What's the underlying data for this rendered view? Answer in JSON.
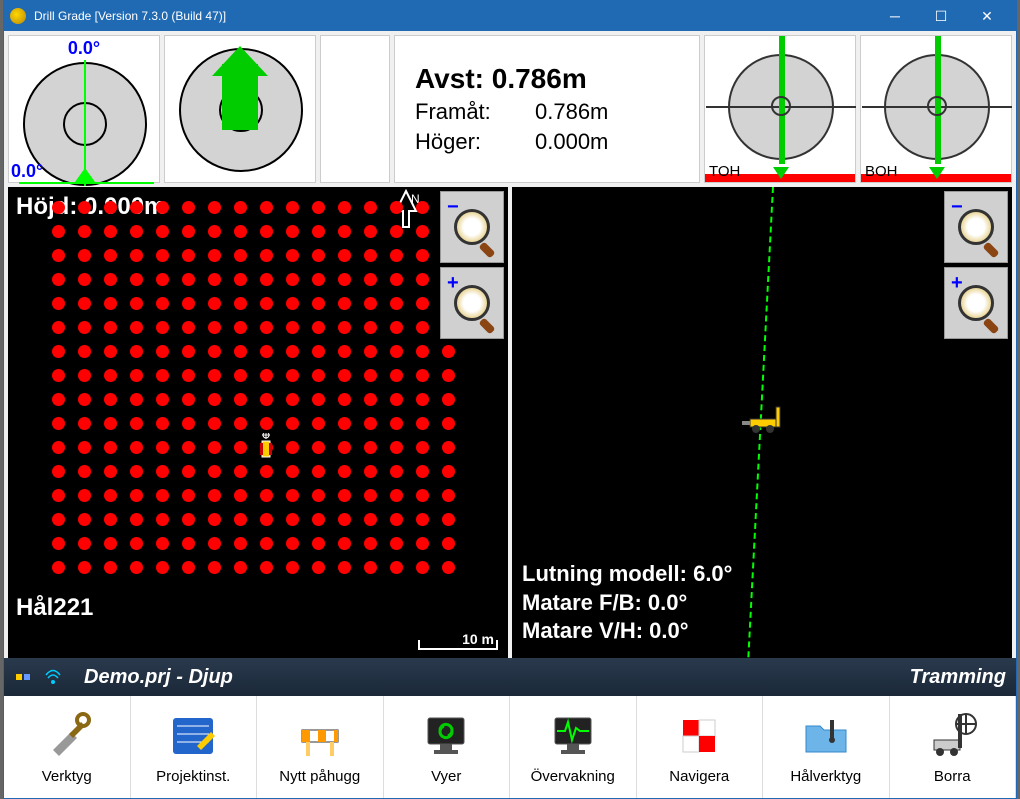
{
  "window": {
    "title": "Drill Grade [Version 7.3.0 (Build 47)]"
  },
  "gauges": {
    "gauge1_top": "0.0°",
    "gauge1_bl": "0.0°",
    "toh_label": "TOH",
    "boh_label": "BOH"
  },
  "readout": {
    "main": "Avst: 0.786m",
    "row1_label": "Framåt:",
    "row1_val": "0.786m",
    "row2_label": "Höger:",
    "row2_val": "0.000m"
  },
  "plan": {
    "height_label": "Höjd: 0.000m",
    "hole_label": "Hål221",
    "scale_label": "10 m"
  },
  "profile": {
    "line1": "Lutning modell: 6.0°",
    "line2": "Matare F/B: 0.0°",
    "line3": "Matare V/H: 0.0°"
  },
  "status": {
    "project": "Demo.prj - Djup",
    "mode": "Tramming"
  },
  "toolbar": {
    "tools": "Verktyg",
    "project": "Projektinst.",
    "newcut": "Nytt påhugg",
    "views": "Vyer",
    "monitor": "Övervakning",
    "navigate": "Navigera",
    "holetools": "Hålverktyg",
    "drill": "Borra"
  }
}
